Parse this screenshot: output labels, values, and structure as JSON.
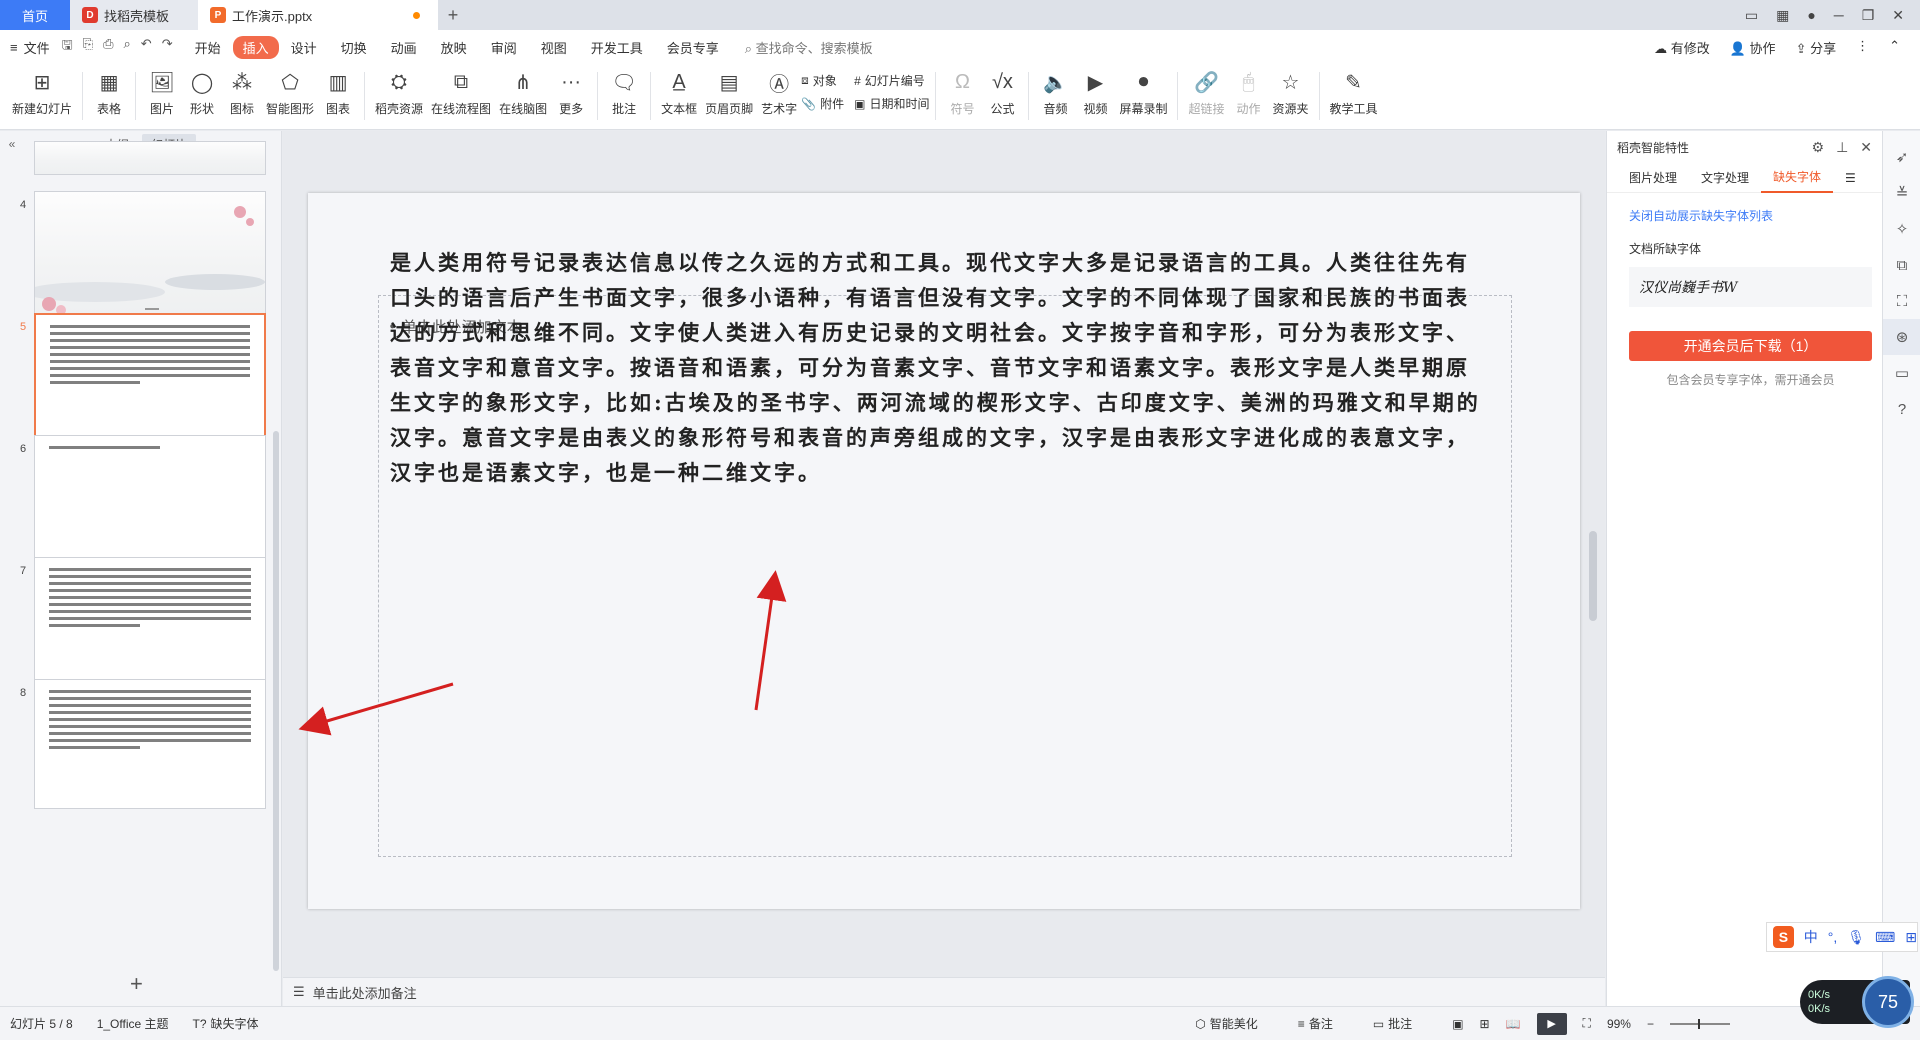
{
  "tabs": {
    "home": "首页",
    "template": "找稻壳模板",
    "doc": "工作演示.pptx"
  },
  "menu": {
    "file": "文件",
    "items": [
      "开始",
      "插入",
      "设计",
      "切换",
      "动画",
      "放映",
      "审阅",
      "视图",
      "开发工具",
      "会员专享"
    ],
    "active_index": 1,
    "search": "查找命令、搜索模板",
    "right": [
      "有修改",
      "协作",
      "分享"
    ]
  },
  "ribbon": {
    "new_slide": "新建幻灯片",
    "table": "表格",
    "picture": "图片",
    "shape": "形状",
    "icon": "图标",
    "smart_shape": "智能图形",
    "chart": "图表",
    "docer_res": "稻壳资源",
    "online_flow": "在线流程图",
    "online_mind": "在线脑图",
    "more": "更多",
    "comment": "批注",
    "textbox": "文本框",
    "header_footer": "页眉页脚",
    "wordart": "艺术字",
    "object": "对象",
    "attachment": "附件",
    "slide_number": "幻灯片编号",
    "datetime": "日期和时间",
    "symbol": "符号",
    "formula": "公式",
    "audio": "音频",
    "video": "视频",
    "screen_rec": "屏幕录制",
    "hyperlink": "超链接",
    "action": "动作",
    "resource": "资源夹",
    "teaching": "教学工具"
  },
  "left_panel": {
    "outline": "大纲",
    "slides": "幻灯片",
    "thumbs": [
      {
        "num": "4"
      },
      {
        "num": "5"
      },
      {
        "num": "6"
      },
      {
        "num": "7"
      },
      {
        "num": "8"
      }
    ],
    "selected": "5"
  },
  "slide": {
    "placeholder": "• 单击此处添加文本",
    "body": "是人类用符号记录表达信息以传之久远的方式和工具。现代文字大多是记录语言的工具。人类往往先有口头的语言后产生书面文字，很多小语种，有语言但没有文字。文字的不同体现了国家和民族的书面表达的方式和思维不同。文字使人类进入有历史记录的文明社会。文字按字音和字形，可分为表形文字、表音文字和意音文字。按语音和语素，可分为音素文字、音节文字和语素文字。表形文字是人类早期原生文字的象形文字，比如:古埃及的圣书字、两河流域的楔形文字、古印度文字、美洲的玛雅文和早期的汉字。意音文字是由表义的象形符号和表音的声旁组成的文字，汉字是由表形文字进化成的表意文字，汉字也是语素文字，也是一种二维文字。"
  },
  "notes": "单击此处添加备注",
  "right_panel": {
    "title": "稻壳智能特性",
    "tabs": [
      "图片处理",
      "文字处理",
      "缺失字体"
    ],
    "active_tab": 2,
    "link": "关闭自动展示缺失字体列表",
    "label": "文档所缺字体",
    "font": "汉仪尚巍手书W",
    "button": "开通会员后下载（1）",
    "note": "包含会员专享字体，需开通会员"
  },
  "status": {
    "slide": "幻灯片 5 / 8",
    "theme": "1_Office 主题",
    "missing_font": "缺失字体",
    "beautify": "智能美化",
    "notes": "备注",
    "comments": "批注",
    "zoom": "99%"
  },
  "ime": {
    "lang": "中"
  },
  "netmon": {
    "up": "0K/s",
    "down": "0K/s",
    "value": "75"
  },
  "colors": {
    "accent": "#f26b4b",
    "home_tab": "#3d7bf6",
    "arrow": "#d42020"
  }
}
